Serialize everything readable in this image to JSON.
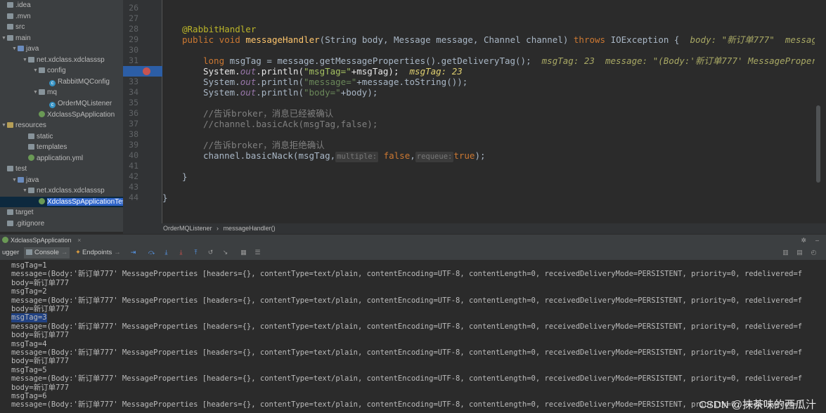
{
  "project_tree": [
    {
      "label": ".idea",
      "type": "folder",
      "arrow": "",
      "indent": 0
    },
    {
      "label": ".mvn",
      "type": "folder",
      "arrow": "",
      "indent": 0
    },
    {
      "label": "src",
      "type": "folder",
      "arrow": "",
      "indent": 0
    },
    {
      "label": "main",
      "type": "folder",
      "arrow": "▼",
      "indent": 0
    },
    {
      "label": "java",
      "type": "folder-src",
      "arrow": "▼",
      "indent": 1
    },
    {
      "label": "net.xdclass.xdclasssp",
      "type": "folder",
      "arrow": "▼",
      "indent": 2
    },
    {
      "label": "config",
      "type": "folder",
      "arrow": "▼",
      "indent": 3
    },
    {
      "label": "RabbitMQConfig",
      "type": "class",
      "arrow": "",
      "indent": 4
    },
    {
      "label": "mq",
      "type": "folder",
      "arrow": "▼",
      "indent": 3
    },
    {
      "label": "OrderMQListener",
      "type": "class",
      "arrow": "",
      "indent": 4
    },
    {
      "label": "XdclassSpApplication",
      "type": "spring",
      "arrow": "",
      "indent": 3
    },
    {
      "label": "resources",
      "type": "folder-res",
      "arrow": "▼",
      "indent": 0
    },
    {
      "label": "static",
      "type": "folder",
      "arrow": "",
      "indent": 2
    },
    {
      "label": "templates",
      "type": "folder",
      "arrow": "",
      "indent": 2
    },
    {
      "label": "application.yml",
      "type": "spring",
      "arrow": "",
      "indent": 2
    },
    {
      "label": "test",
      "type": "folder",
      "arrow": "",
      "indent": 0
    },
    {
      "label": "java",
      "type": "folder-src",
      "arrow": "▼",
      "indent": 1
    },
    {
      "label": "net.xdclass.xdclasssp",
      "type": "folder",
      "arrow": "▼",
      "indent": 2
    },
    {
      "label": "XdclassSpApplicationTests",
      "type": "spring",
      "arrow": "",
      "indent": 3
    },
    {
      "label": "target",
      "type": "folder",
      "arrow": "",
      "indent": 0
    },
    {
      "label": ".gitignore",
      "type": "file",
      "arrow": "",
      "indent": 0
    }
  ],
  "editor": {
    "line_numbers": [
      "26",
      "27",
      "28",
      "29",
      "30",
      "31",
      "32",
      "33",
      "34",
      "35",
      "36",
      "37",
      "38",
      "39",
      "40",
      "41",
      "42",
      "43",
      "44"
    ],
    "lines": {
      "l28": "@RabbitHandler",
      "l29_kw1": "public void ",
      "l29_fn": "messageHandler",
      "l29_rest": "(String body, Message message, Channel channel) ",
      "l29_kw2": "throws ",
      "l29_end": "IOException {",
      "l29_dbg": "  body: \"新订单777\"  message: \"(Bo",
      "l31_kw": "long ",
      "l31_code": "msgTag = message.getMessageProperties().getDeliveryTag();",
      "l31_dbg": "  msgTag: 23  message: \"(Body:'新订单777' MessageProperties [h",
      "l32_a": "System.",
      "l32_out": "out",
      "l32_b": ".println(",
      "l32_str": "\"msgTag=\"",
      "l32_c": "+msgTag);",
      "l32_dbg": "  msgTag: 23",
      "l33_a": "System.",
      "l33_out": "out",
      "l33_b": ".println(",
      "l33_str": "\"message=\"",
      "l33_c": "+message.toString());",
      "l34_a": "System.",
      "l34_out": "out",
      "l34_b": ".println(",
      "l34_str": "\"body=\"",
      "l34_c": "+body);",
      "l36": "//告诉broker，消息已经被确认",
      "l37": "//channel.basicAck(msgTag,false);",
      "l39": "//告诉broker，消息拒绝确认",
      "l40_a": "channel.basicNack(msgTag,",
      "l40_hint1": "multiple:",
      "l40_v1": "false",
      "l40_comma": ",",
      "l40_hint2": "requeue:",
      "l40_v2": "true",
      "l40_end": ");",
      "l42": "}",
      "l44": "}"
    }
  },
  "breadcrumb": {
    "class": "OrderMQListener",
    "sep": "›",
    "method": "messageHandler()"
  },
  "run_window": {
    "title": "XdclassSpApplication",
    "tabs": {
      "debugger": "ugger",
      "console": "Console",
      "endpoints": "Endpoints"
    }
  },
  "console_lines": [
    "msgTag=1",
    "message=(Body:'新订单777' MessageProperties [headers={}, contentType=text/plain, contentEncoding=UTF-8, contentLength=0, receivedDeliveryMode=PERSISTENT, priority=0, redelivered=f",
    "body=新订单777",
    "msgTag=2",
    "message=(Body:'新订单777' MessageProperties [headers={}, contentType=text/plain, contentEncoding=UTF-8, contentLength=0, receivedDeliveryMode=PERSISTENT, priority=0, redelivered=f",
    "body=新订单777",
    "msgTag=3",
    "message=(Body:'新订单777' MessageProperties [headers={}, contentType=text/plain, contentEncoding=UTF-8, contentLength=0, receivedDeliveryMode=PERSISTENT, priority=0, redelivered=f",
    "body=新订单777",
    "msgTag=4",
    "message=(Body:'新订单777' MessageProperties [headers={}, contentType=text/plain, contentEncoding=UTF-8, contentLength=0, receivedDeliveryMode=PERSISTENT, priority=0, redelivered=f",
    "body=新订单777",
    "msgTag=5",
    "message=(Body:'新订单777' MessageProperties [headers={}, contentType=text/plain, contentEncoding=UTF-8, contentLength=0, receivedDeliveryMode=PERSISTENT, priority=0, redelivered=f",
    "body=新订单777",
    "msgTag=6",
    "message=(Body:'新订单777' MessageProperties [headers={}, contentType=text/plain, contentEncoding=UTF-8, contentLength=0, receivedDeliveryMode=PERSISTENT, priority=0, redelivered=f"
  ],
  "watermark": "CSDN @抹茶味的西瓜汁",
  "colors": {
    "keyword": "#cc7832",
    "string": "#6a8759",
    "highlight": "#2c5ea6",
    "breakpoint": "#c75450"
  }
}
